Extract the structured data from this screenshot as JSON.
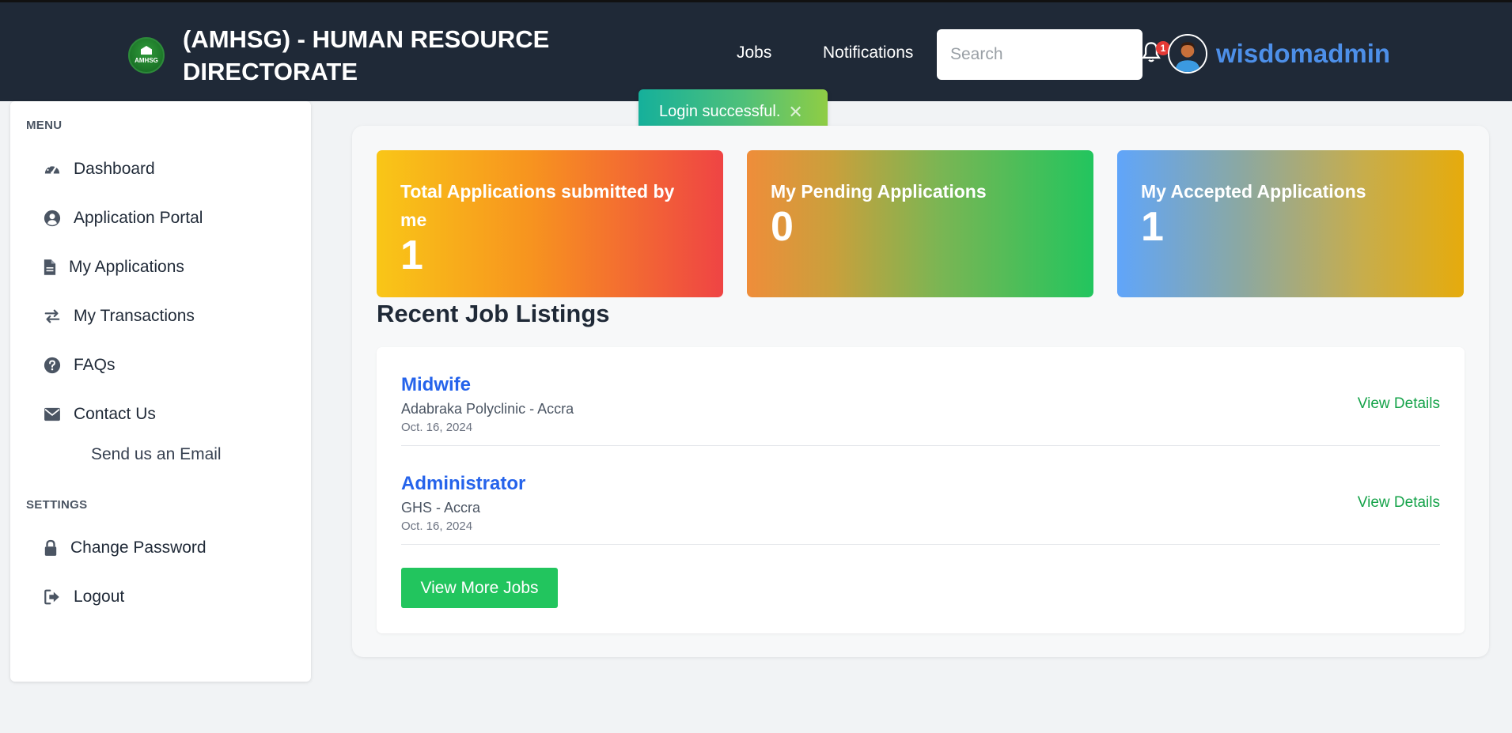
{
  "header": {
    "logo_text": "AMHSG",
    "brand": "(AMHSG) - HUMAN RESOURCE DIRECTORATE",
    "nav": [
      {
        "label": "Jobs"
      },
      {
        "label": "Notifications"
      }
    ],
    "search": {
      "placeholder": "Search",
      "value": ""
    },
    "notification_count": "1",
    "username": "wisdomadmin"
  },
  "toast": {
    "message": "Login successful.",
    "close_glyph": "✕"
  },
  "sidebar": {
    "menu_heading": "MENU",
    "items": [
      {
        "label": "Dashboard",
        "icon": "gauge-icon"
      },
      {
        "label": "Application Portal",
        "icon": "user-circle-icon"
      },
      {
        "label": "My Applications",
        "icon": "file-icon"
      },
      {
        "label": "My Transactions",
        "icon": "exchange-icon"
      },
      {
        "label": "FAQs",
        "icon": "question-circle-icon"
      },
      {
        "label": "Contact Us",
        "icon": "envelope-icon"
      }
    ],
    "contact_sub": "Send us an Email",
    "settings_heading": "SETTINGS",
    "settings_items": [
      {
        "label": "Change Password",
        "icon": "lock-icon"
      },
      {
        "label": "Logout",
        "icon": "sign-out-icon"
      }
    ]
  },
  "stats": [
    {
      "title": "Total Applications submitted by me",
      "value": "1",
      "colors": [
        "#f9c617",
        "#ef4444"
      ]
    },
    {
      "title": "My Pending Applications",
      "value": "0",
      "colors": [
        "#ef8d3a",
        "#22c55e"
      ]
    },
    {
      "title": "My Accepted Applications",
      "value": "1",
      "colors": [
        "#60a5fa",
        "#e6ab0c"
      ]
    }
  ],
  "recent_jobs": {
    "heading": "Recent Job Listings",
    "jobs": [
      {
        "title": "Midwife",
        "org": "Adabraka Polyclinic - Accra",
        "date": "Oct. 16, 2024",
        "link": "View Details"
      },
      {
        "title": "Administrator",
        "org": "GHS - Accra",
        "date": "Oct. 16, 2024",
        "link": "View Details"
      }
    ],
    "more_button": "View More Jobs"
  },
  "colors": {
    "header_bg": "#1f2937",
    "accent_blue": "#2563eb",
    "accent_green": "#22c55e",
    "username_blue": "#4d8fe8"
  }
}
